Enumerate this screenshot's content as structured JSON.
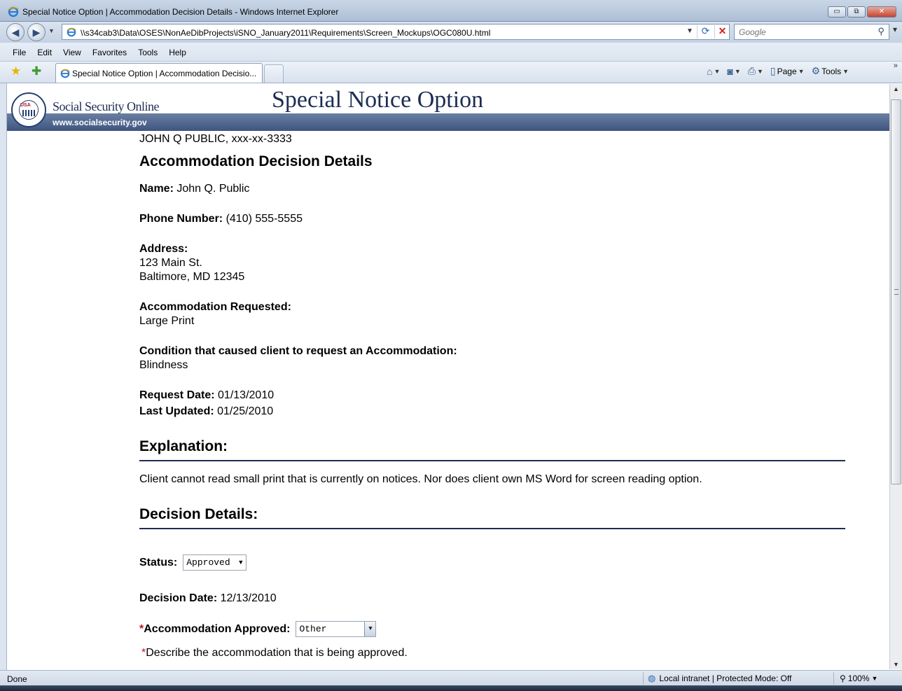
{
  "window": {
    "title": "Special Notice Option | Accommodation Decision Details - Windows Internet Explorer",
    "minimize": "▭",
    "restore": "⧉",
    "close": "✕"
  },
  "address_bar": {
    "url": "\\\\s34cab3\\Data\\OSES\\NonAeDibProjects\\iSNO_January2011\\Requirements\\Screen_Mockups\\OGC080U.html",
    "search_placeholder": "Google"
  },
  "menu": [
    "File",
    "Edit",
    "View",
    "Favorites",
    "Tools",
    "Help"
  ],
  "tab": {
    "label": "Special Notice Option | Accommodation Decisio..."
  },
  "command_bar": {
    "page_label": "Page",
    "tools_label": "Tools"
  },
  "site": {
    "brand": "Social Security Online",
    "url": "www.socialsecurity.gov",
    "seal_text": "USA",
    "page_title": "Special Notice Option"
  },
  "content": {
    "client_line": "JOHN Q PUBLIC, xxx-xx-3333",
    "heading": "Accommodation Decision Details",
    "name_label": "Name:",
    "name_value": "John Q. Public",
    "phone_label": "Phone Number:",
    "phone_value": "(410) 555-5555",
    "address_label": "Address:",
    "address_line1": "123 Main St.",
    "address_line2": "Baltimore, MD 12345",
    "accommodation_label": "Accommodation Requested:",
    "accommodation_value": "Large Print",
    "condition_label": "Condition that caused client to request an Accommodation:",
    "condition_value": "Blindness",
    "request_date_label": "Request Date:",
    "request_date_value": "01/13/2010",
    "last_updated_label": "Last Updated:",
    "last_updated_value": "01/25/2010",
    "explanation_heading": "Explanation:",
    "explanation_text": "Client cannot read small print that is currently on notices. Nor does client own MS Word for screen reading option.",
    "decision_heading": "Decision Details:",
    "status_label": "Status:",
    "status_value": "Approved",
    "decision_date_label": "Decision Date:",
    "decision_date_value": "12/13/2010",
    "required_marker": "*",
    "accommodation_approved_label": "Accommodation Approved:",
    "accommodation_approved_value": "Other",
    "describe_label": "Describe the accommodation that is being approved."
  },
  "status_bar": {
    "status": "Done",
    "zone": "Local intranet | Protected Mode: Off",
    "zoom": "100%"
  }
}
